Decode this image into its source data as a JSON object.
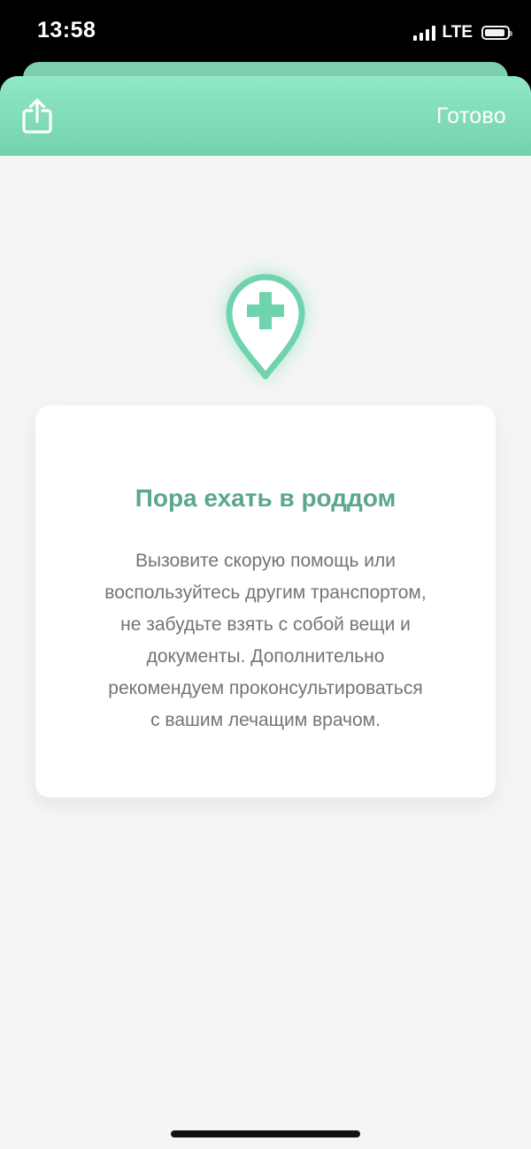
{
  "status_bar": {
    "time": "13:58",
    "network": "LTE",
    "icons": [
      "signal-icon",
      "battery-icon"
    ],
    "battery_level": 0.9
  },
  "nav": {
    "share_icon": "share-icon",
    "done_label": "Готово"
  },
  "card": {
    "icon": "location-pin-plus-icon",
    "title": "Пора ехать в роддом",
    "body_lines": [
      "Вызовите скорую помощь или",
      "воспользуйтесь другим транспортом,",
      "не забудьте взять с собой вещи и",
      "документы. Дополнительно",
      "рекомендуем проконсультироваться",
      "с вашим лечащим врачом."
    ]
  },
  "colors": {
    "accent": "#74d1ae",
    "title": "#5aa88a",
    "background": "#f5f5f5"
  }
}
